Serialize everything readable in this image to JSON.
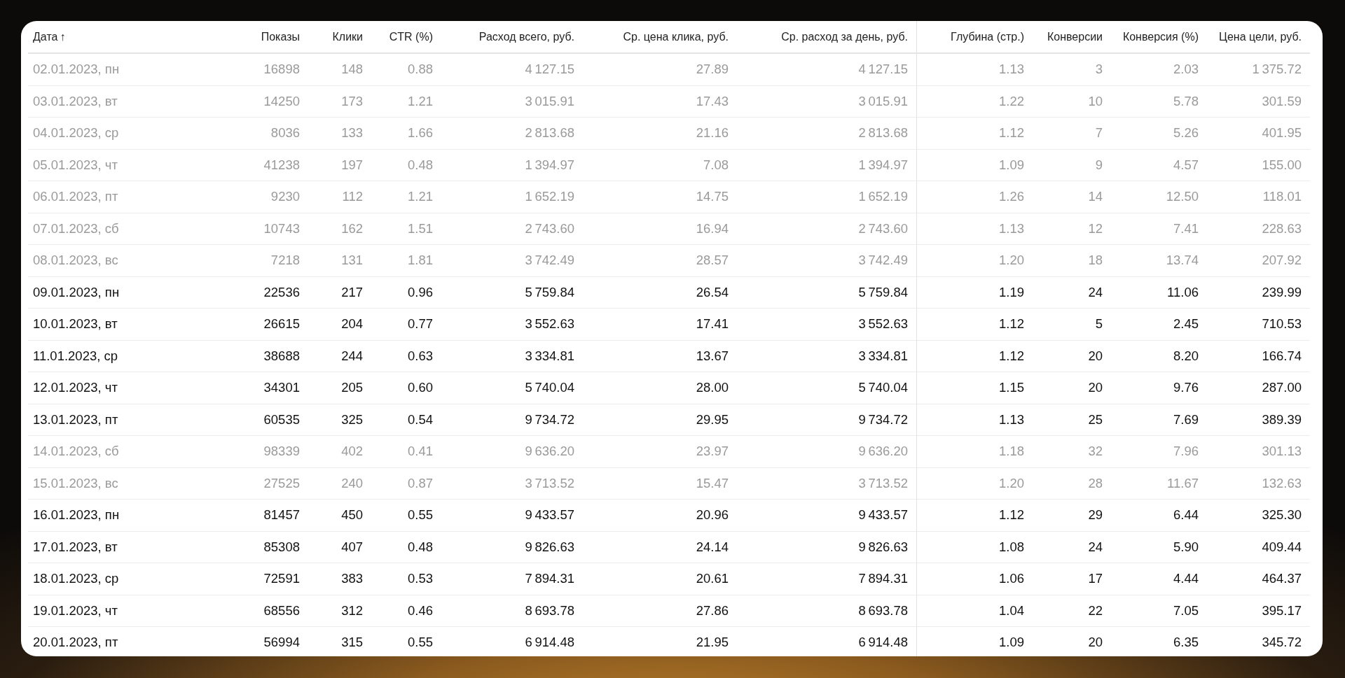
{
  "table": {
    "columns": [
      {
        "label": "Дата",
        "sort_arrow": "↑"
      },
      {
        "label": "Показы"
      },
      {
        "label": "Клики"
      },
      {
        "label": "CTR (%)"
      },
      {
        "label": "Расход всего, руб."
      },
      {
        "label": "Ср. цена клика, руб."
      },
      {
        "label": "Ср. расход за день, руб."
      },
      {
        "label": "Глубина (стр.)"
      },
      {
        "label": "Конверсии"
      },
      {
        "label": "Конверсия (%)"
      },
      {
        "label": "Цена цели, руб."
      }
    ],
    "rows": [
      {
        "muted": true,
        "cells": [
          "02.01.2023, пн",
          "16898",
          "148",
          "0.88",
          "4 127.15",
          "27.89",
          "4 127.15",
          "1.13",
          "3",
          "2.03",
          "1 375.72"
        ]
      },
      {
        "muted": true,
        "cells": [
          "03.01.2023, вт",
          "14250",
          "173",
          "1.21",
          "3 015.91",
          "17.43",
          "3 015.91",
          "1.22",
          "10",
          "5.78",
          "301.59"
        ]
      },
      {
        "muted": true,
        "cells": [
          "04.01.2023, ср",
          "8036",
          "133",
          "1.66",
          "2 813.68",
          "21.16",
          "2 813.68",
          "1.12",
          "7",
          "5.26",
          "401.95"
        ]
      },
      {
        "muted": true,
        "cells": [
          "05.01.2023, чт",
          "41238",
          "197",
          "0.48",
          "1 394.97",
          "7.08",
          "1 394.97",
          "1.09",
          "9",
          "4.57",
          "155.00"
        ]
      },
      {
        "muted": true,
        "cells": [
          "06.01.2023, пт",
          "9230",
          "112",
          "1.21",
          "1 652.19",
          "14.75",
          "1 652.19",
          "1.26",
          "14",
          "12.50",
          "118.01"
        ]
      },
      {
        "muted": true,
        "cells": [
          "07.01.2023, сб",
          "10743",
          "162",
          "1.51",
          "2 743.60",
          "16.94",
          "2 743.60",
          "1.13",
          "12",
          "7.41",
          "228.63"
        ]
      },
      {
        "muted": true,
        "cells": [
          "08.01.2023, вс",
          "7218",
          "131",
          "1.81",
          "3 742.49",
          "28.57",
          "3 742.49",
          "1.20",
          "18",
          "13.74",
          "207.92"
        ]
      },
      {
        "muted": false,
        "cells": [
          "09.01.2023, пн",
          "22536",
          "217",
          "0.96",
          "5 759.84",
          "26.54",
          "5 759.84",
          "1.19",
          "24",
          "11.06",
          "239.99"
        ]
      },
      {
        "muted": false,
        "cells": [
          "10.01.2023, вт",
          "26615",
          "204",
          "0.77",
          "3 552.63",
          "17.41",
          "3 552.63",
          "1.12",
          "5",
          "2.45",
          "710.53"
        ]
      },
      {
        "muted": false,
        "cells": [
          "11.01.2023, ср",
          "38688",
          "244",
          "0.63",
          "3 334.81",
          "13.67",
          "3 334.81",
          "1.12",
          "20",
          "8.20",
          "166.74"
        ]
      },
      {
        "muted": false,
        "cells": [
          "12.01.2023, чт",
          "34301",
          "205",
          "0.60",
          "5 740.04",
          "28.00",
          "5 740.04",
          "1.15",
          "20",
          "9.76",
          "287.00"
        ]
      },
      {
        "muted": false,
        "cells": [
          "13.01.2023, пт",
          "60535",
          "325",
          "0.54",
          "9 734.72",
          "29.95",
          "9 734.72",
          "1.13",
          "25",
          "7.69",
          "389.39"
        ]
      },
      {
        "muted": true,
        "cells": [
          "14.01.2023, сб",
          "98339",
          "402",
          "0.41",
          "9 636.20",
          "23.97",
          "9 636.20",
          "1.18",
          "32",
          "7.96",
          "301.13"
        ]
      },
      {
        "muted": true,
        "cells": [
          "15.01.2023, вс",
          "27525",
          "240",
          "0.87",
          "3 713.52",
          "15.47",
          "3 713.52",
          "1.20",
          "28",
          "11.67",
          "132.63"
        ]
      },
      {
        "muted": false,
        "cells": [
          "16.01.2023, пн",
          "81457",
          "450",
          "0.55",
          "9 433.57",
          "20.96",
          "9 433.57",
          "1.12",
          "29",
          "6.44",
          "325.30"
        ]
      },
      {
        "muted": false,
        "cells": [
          "17.01.2023, вт",
          "85308",
          "407",
          "0.48",
          "9 826.63",
          "24.14",
          "9 826.63",
          "1.08",
          "24",
          "5.90",
          "409.44"
        ]
      },
      {
        "muted": false,
        "cells": [
          "18.01.2023, ср",
          "72591",
          "383",
          "0.53",
          "7 894.31",
          "20.61",
          "7 894.31",
          "1.06",
          "17",
          "4.44",
          "464.37"
        ]
      },
      {
        "muted": false,
        "cells": [
          "19.01.2023, чт",
          "68556",
          "312",
          "0.46",
          "8 693.78",
          "27.86",
          "8 693.78",
          "1.04",
          "22",
          "7.05",
          "395.17"
        ]
      },
      {
        "muted": false,
        "cells": [
          "20.01.2023, пт",
          "56994",
          "315",
          "0.55",
          "6 914.48",
          "21.95",
          "6 914.48",
          "1.09",
          "20",
          "6.35",
          "345.72"
        ]
      }
    ]
  }
}
